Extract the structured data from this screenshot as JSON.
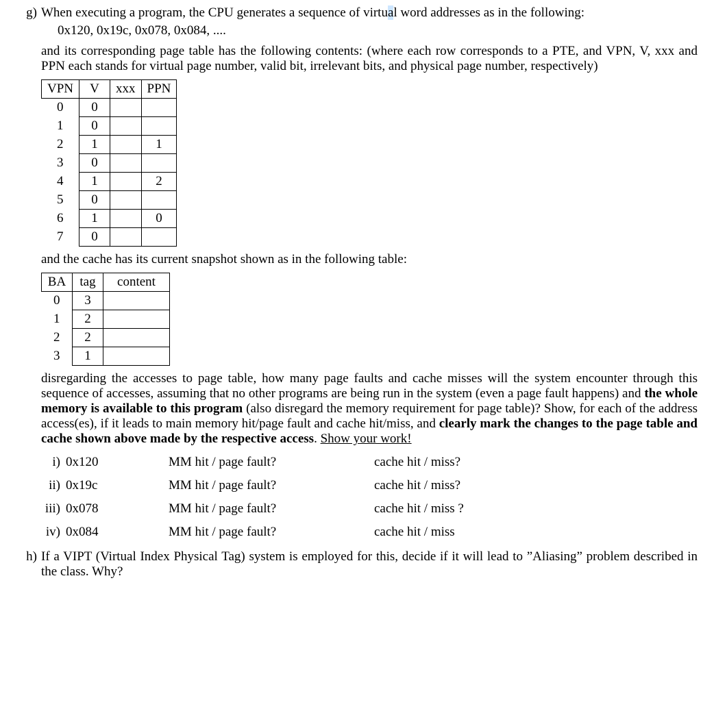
{
  "g": {
    "label": "g)",
    "intro_part1": "When executing a program, the CPU generates a sequence of virtu",
    "intro_hilite": "a",
    "intro_part2": "l word addresses as in the following:",
    "addr_line": "0x120, 0x19c, 0x078, 0x084, ....",
    "intro2": "and its corresponding page table has the following contents: (where each row corresponds to a PTE, and VPN, V, xxx and PPN each stands for virtual page number, valid bit, irrelevant bits, and physical page number, respectively)",
    "ptable": {
      "headers": [
        "VPN",
        "V",
        "xxx",
        "PPN"
      ],
      "rows": [
        {
          "vpn": "0",
          "v": "0",
          "xxx": "",
          "ppn": ""
        },
        {
          "vpn": "1",
          "v": "0",
          "xxx": "",
          "ppn": ""
        },
        {
          "vpn": "2",
          "v": "1",
          "xxx": "",
          "ppn": "1"
        },
        {
          "vpn": "3",
          "v": "0",
          "xxx": "",
          "ppn": ""
        },
        {
          "vpn": "4",
          "v": "1",
          "xxx": "",
          "ppn": "2"
        },
        {
          "vpn": "5",
          "v": "0",
          "xxx": "",
          "ppn": ""
        },
        {
          "vpn": "6",
          "v": "1",
          "xxx": "",
          "ppn": "0"
        },
        {
          "vpn": "7",
          "v": "0",
          "xxx": "",
          "ppn": ""
        }
      ]
    },
    "cache_intro": "and the cache has its current snapshot shown as in the following table:",
    "ctable": {
      "headers": [
        "BA",
        "tag",
        "content"
      ],
      "rows": [
        {
          "ba": "0",
          "tag": "3",
          "content": ""
        },
        {
          "ba": "1",
          "tag": "2",
          "content": ""
        },
        {
          "ba": "2",
          "tag": "2",
          "content": ""
        },
        {
          "ba": "3",
          "tag": "1",
          "content": ""
        }
      ]
    },
    "question_a": "disregarding the accesses to page table, how many page faults and cache misses will the system encounter through this sequence of accesses, assuming that no other programs are being run in the system (even a page fault happens) and ",
    "question_b_bold": "the whole memory is available to this program",
    "question_c": " (also disregard the memory requirement for page table)? Show, for each of the address access(es), if it leads to main memory hit/page fault and cache hit/miss, and ",
    "question_d_bold": "clearly mark the changes to the page table and cache shown above made by the respective access",
    "question_e": ". ",
    "question_f_u": "Show your work!",
    "items": [
      {
        "num": "i)",
        "addr": "0x120",
        "mm": "MM hit / page fault?",
        "cache": "cache hit / miss?"
      },
      {
        "num": "ii)",
        "addr": "0x19c",
        "mm": "MM hit / page fault?",
        "cache": "cache hit / miss?"
      },
      {
        "num": "iii)",
        "addr": "0x078",
        "mm": "MM hit / page fault?",
        "cache": "cache hit / miss ?"
      },
      {
        "num": "iv)",
        "addr": "0x084",
        "mm": "MM hit / page fault?",
        "cache": "cache hit / miss"
      }
    ]
  },
  "h": {
    "label": "h)",
    "text": "If a VIPT (Virtual Index Physical Tag) system is employed for this, decide if it will lead to ”Aliasing” problem described in the class. Why?"
  }
}
